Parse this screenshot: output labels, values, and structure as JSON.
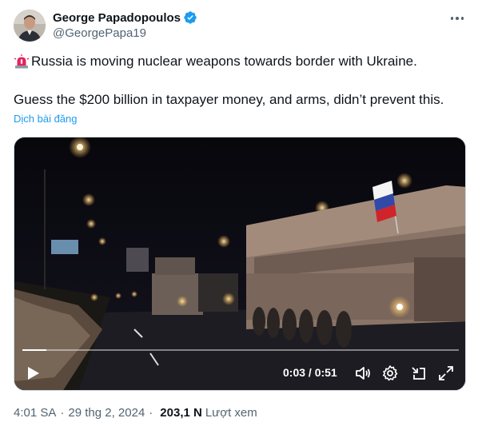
{
  "author": {
    "display_name": "George Papadopoulos",
    "handle": "@GeorgePapa19",
    "verified": true
  },
  "tweet": {
    "line1": "Russia is moving nuclear weapons towards border with Ukraine.",
    "line2": "Guess the $200 billion in taxpayer money, and arms, didn’t prevent this.",
    "translate_label": "Dịch bài đăng",
    "emoji": "siren-icon"
  },
  "video": {
    "current_time": "0:03",
    "duration": "0:51",
    "time_display": "0:03 / 0:51",
    "progress_fraction": 0.055,
    "icons": [
      "play-icon",
      "volume-icon",
      "settings-icon",
      "fullscreen-exit-icon",
      "expand-icon"
    ]
  },
  "meta": {
    "time": "4:01 SA",
    "date": "29 thg 2, 2024",
    "views_count": "203,1 N",
    "views_label": "Lượt xem"
  },
  "colors": {
    "accent": "#1d9bf0",
    "text": "#0f1419",
    "secondary": "#536471"
  }
}
